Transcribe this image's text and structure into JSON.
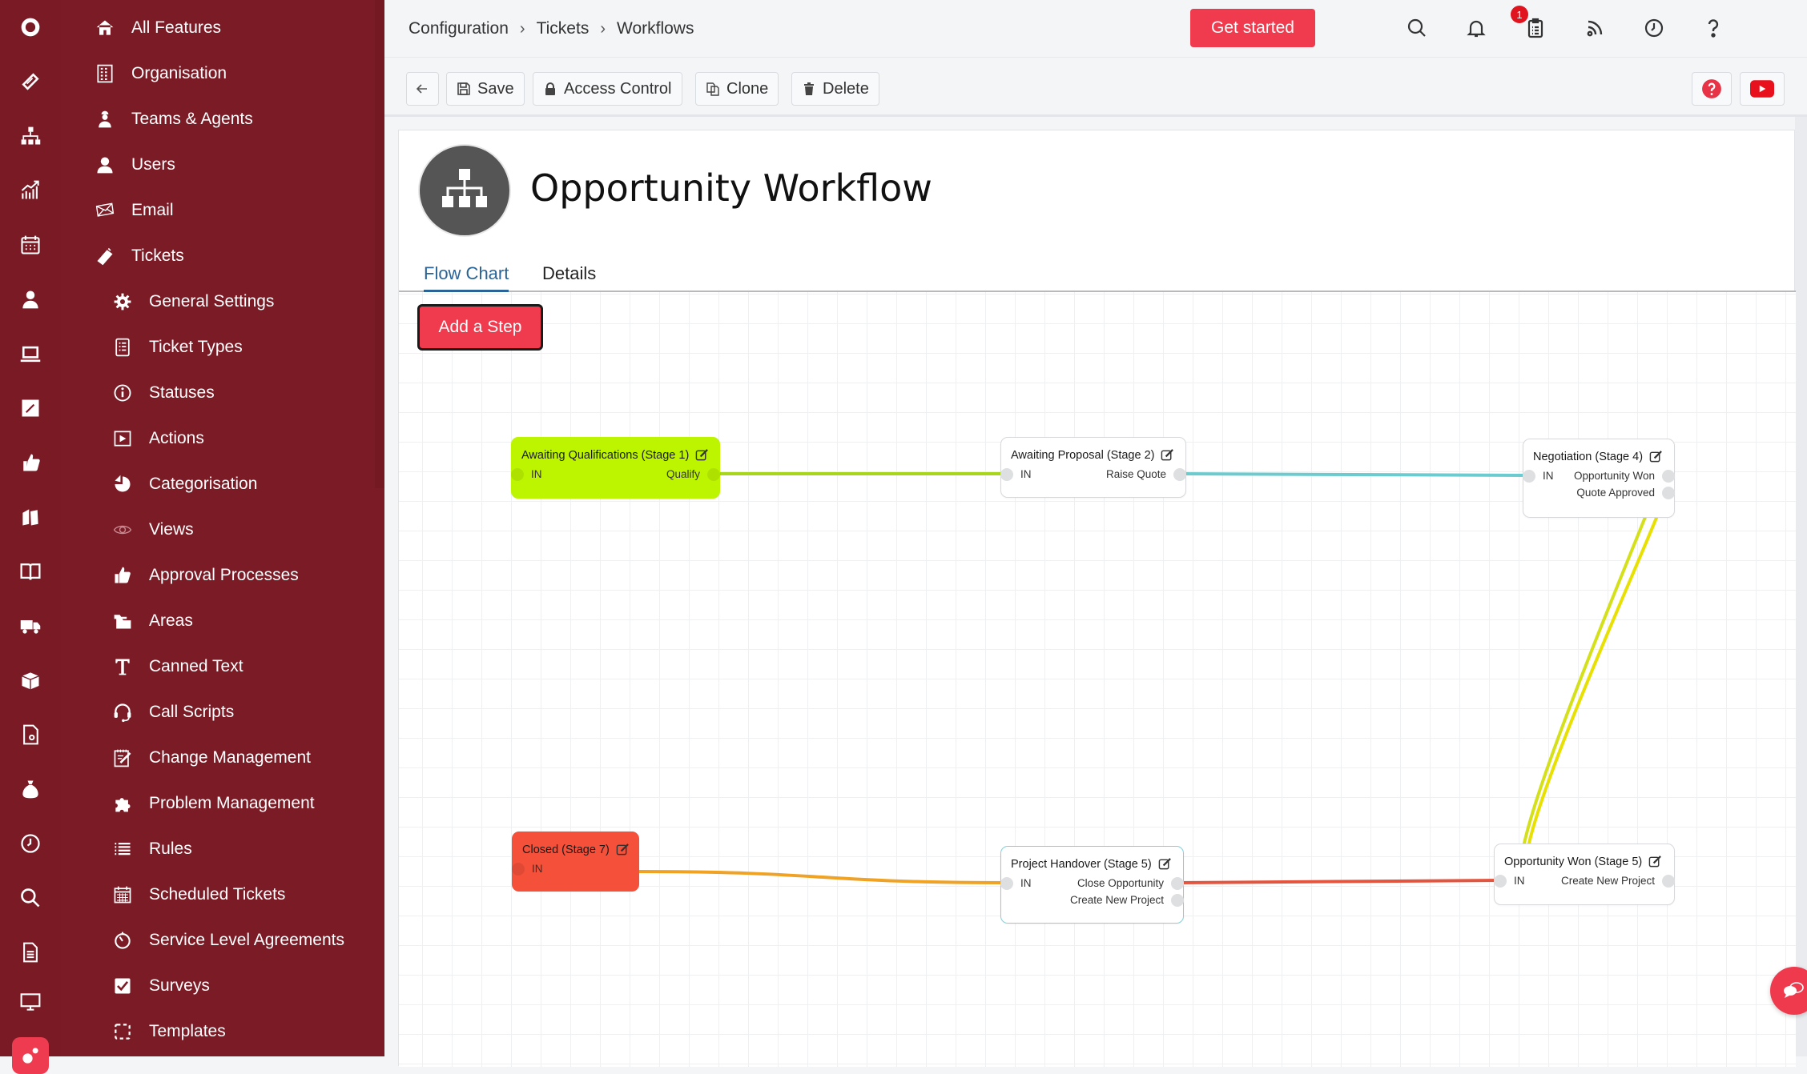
{
  "rail": {
    "icons": [
      "app-logo-icon",
      "ticket-icon",
      "org-chart-icon",
      "analytics-icon",
      "calendar-icon",
      "agent-icon",
      "laptop-icon",
      "edit-icon",
      "thumbs-up-icon",
      "boxes-icon",
      "book-icon",
      "truck-icon",
      "box-icon",
      "search-document-icon",
      "money-bag-icon",
      "clock-icon",
      "search-icon",
      "document-icon",
      "monitor-icon",
      "settings-gears-icon"
    ],
    "active": "settings-gears-icon"
  },
  "nav": {
    "items": [
      {
        "label": "All Features",
        "icon": "home-icon",
        "sub": false
      },
      {
        "label": "Organisation",
        "icon": "building-icon",
        "sub": false
      },
      {
        "label": "Teams & Agents",
        "icon": "worker-icon",
        "sub": false
      },
      {
        "label": "Users",
        "icon": "user-icon",
        "sub": false
      },
      {
        "label": "Email",
        "icon": "envelope-icon",
        "sub": false
      },
      {
        "label": "Tickets",
        "icon": "ticket-icon",
        "sub": false
      },
      {
        "label": "General Settings",
        "icon": "gear-icon",
        "sub": true
      },
      {
        "label": "Ticket Types",
        "icon": "list-document-icon",
        "sub": true
      },
      {
        "label": "Statuses",
        "icon": "info-circle-icon",
        "sub": true
      },
      {
        "label": "Actions",
        "icon": "play-box-icon",
        "sub": true
      },
      {
        "label": "Categorisation",
        "icon": "pie-chart-icon",
        "sub": true
      },
      {
        "label": "Views",
        "icon": "eye-icon",
        "sub": true
      },
      {
        "label": "Approval Processes",
        "icon": "thumbs-up-icon",
        "sub": true
      },
      {
        "label": "Areas",
        "icon": "folders-icon",
        "sub": true
      },
      {
        "label": "Canned Text",
        "icon": "text-t-icon",
        "sub": true
      },
      {
        "label": "Call Scripts",
        "icon": "headset-icon",
        "sub": true
      },
      {
        "label": "Change Management",
        "icon": "notepad-edit-icon",
        "sub": true
      },
      {
        "label": "Problem Management",
        "icon": "puzzle-icon",
        "sub": true
      },
      {
        "label": "Rules",
        "icon": "list-icon",
        "sub": true
      },
      {
        "label": "Scheduled Tickets",
        "icon": "calendar-grid-icon",
        "sub": true
      },
      {
        "label": "Service Level Agreements",
        "icon": "stopwatch-icon",
        "sub": true
      },
      {
        "label": "Surveys",
        "icon": "checkbox-icon",
        "sub": true
      },
      {
        "label": "Templates",
        "icon": "dashed-square-icon",
        "sub": true
      }
    ]
  },
  "topbar": {
    "breadcrumb": [
      "Configuration",
      "Tickets",
      "Workflows"
    ],
    "breadcrumb_sep": "›",
    "get_started": "Get started",
    "icons": [
      "search-icon",
      "bell-icon",
      "clipboard-icon",
      "rss-icon",
      "history-clock-icon",
      "help-icon"
    ],
    "clipboard_badge": "1"
  },
  "toolbar": {
    "back_label": "",
    "save": "Save",
    "access_control": "Access Control",
    "clone": "Clone",
    "delete": "Delete"
  },
  "workflow": {
    "title": "Opportunity Workflow",
    "tabs": [
      {
        "label": "Flow Chart",
        "active": true
      },
      {
        "label": "Details",
        "active": false
      }
    ],
    "add_step": "Add a Step"
  },
  "flowchart": {
    "nodes": [
      {
        "id": "s1",
        "title": "Awaiting Qualifications (Stage 1)",
        "color": "#bdf500",
        "border": "#bdf500",
        "inputs": [
          "IN"
        ],
        "outputs": [
          "Qualify"
        ]
      },
      {
        "id": "s2",
        "title": "Awaiting Proposal (Stage 2)",
        "color": "#ffffff",
        "border": "#d6d8db",
        "inputs": [
          "IN"
        ],
        "outputs": [
          "Raise Quote"
        ]
      },
      {
        "id": "s4",
        "title": "Negotiation (Stage 4)",
        "color": "#ffffff",
        "border": "#d6d8db",
        "inputs": [
          "IN"
        ],
        "outputs": [
          "Opportunity Won",
          "Quote Approved"
        ]
      },
      {
        "id": "s7",
        "title": "Closed (Stage 7)",
        "color": "#f4503a",
        "border": "#f4503a",
        "inputs": [
          "IN"
        ],
        "outputs": []
      },
      {
        "id": "s5h",
        "title": "Project Handover (Stage 5)",
        "color": "#ffffff",
        "border": "#7fd3dd",
        "inputs": [
          "IN"
        ],
        "outputs": [
          "Close Opportunity",
          "Create New Project"
        ]
      },
      {
        "id": "s5w",
        "title": "Opportunity Won (Stage 5)",
        "color": "#ffffff",
        "border": "#d6d8db",
        "inputs": [
          "IN"
        ],
        "outputs": [
          "Create New Project"
        ]
      }
    ],
    "links": [
      {
        "from": "s1",
        "from_port": "Qualify",
        "to": "s2",
        "color": "#a8d61a"
      },
      {
        "from": "s2",
        "from_port": "Raise Quote",
        "to": "s4",
        "color": "#6ccbcf"
      },
      {
        "from": "s4",
        "from_port": "Opportunity Won",
        "to": "s5w",
        "color": "#d4e01a"
      },
      {
        "from": "s4",
        "from_port": "Quote Approved",
        "to": "s5w",
        "color": "#e8e000"
      },
      {
        "from": "s5w",
        "from_port": "IN",
        "to": "s5h",
        "color": "#e3553f"
      },
      {
        "from": "s7",
        "from_port": "",
        "to": "s5h",
        "color": "#f0a224"
      }
    ]
  },
  "widgets": {
    "help_button": "help-icon",
    "youtube_button": "youtube-icon",
    "chat_button": "chat-icon"
  }
}
